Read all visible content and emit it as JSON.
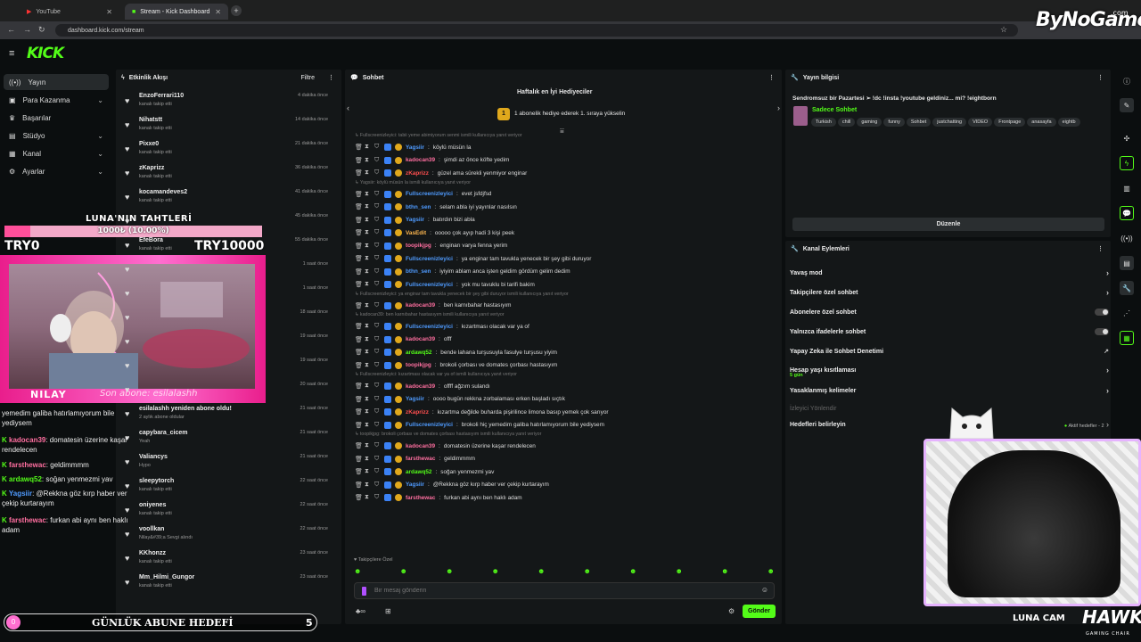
{
  "browser": {
    "tabs": [
      {
        "title": "YouTube",
        "active": false
      },
      {
        "title": "Stream - Kick Dashboard",
        "active": true
      }
    ],
    "url": "dashboard.kick.com/stream"
  },
  "brand": {
    "logo": "KICK",
    "watermark": "ByNoGame",
    "watermark_suffix": ".com",
    "accent": "#53fc18"
  },
  "sidebar": {
    "items": [
      {
        "label": "Yayın",
        "icon": "broadcast-icon",
        "active": true,
        "chevron": false
      },
      {
        "label": "Para Kazanma",
        "icon": "money-icon",
        "active": false,
        "chevron": true
      },
      {
        "label": "Başarılar",
        "icon": "trophy-icon",
        "active": false,
        "chevron": false
      },
      {
        "label": "Stüdyo",
        "icon": "studio-icon",
        "active": false,
        "chevron": true
      },
      {
        "label": "Kanal",
        "icon": "channel-icon",
        "active": false,
        "chevron": true
      },
      {
        "label": "Ayarlar",
        "icon": "gear-icon",
        "active": false,
        "chevron": true
      }
    ]
  },
  "activity": {
    "title": "Etkinlik Akışı",
    "filter": "Filtre",
    "items": [
      {
        "name": "EnzoFerrari110",
        "sub": "kanalı takip etti",
        "time": "4 dakika önce"
      },
      {
        "name": "Nihatstt",
        "sub": "kanalı takip etti",
        "time": "14 dakika önce"
      },
      {
        "name": "Pixxe0",
        "sub": "kanalı takip etti",
        "time": "21 dakika önce"
      },
      {
        "name": "zKaprizz",
        "sub": "kanalı takip etti",
        "time": "36 dakika önce"
      },
      {
        "name": "kocamandeves2",
        "sub": "kanalı takip etti",
        "time": "41 dakika önce"
      },
      {
        "name": "",
        "sub": "",
        "time": "45 dakika önce"
      },
      {
        "name": "EfeBora",
        "sub": "kanalı takip etti",
        "time": "55 dakika önce"
      },
      {
        "name": "",
        "sub": "",
        "time": "1 saat önce"
      },
      {
        "name": "",
        "sub": "",
        "time": "1 saat önce"
      },
      {
        "name": "",
        "sub": "",
        "time": "18 saat önce"
      },
      {
        "name": "",
        "sub": "",
        "time": "19 saat önce"
      },
      {
        "name": "",
        "sub": "",
        "time": "19 saat önce"
      },
      {
        "name": "",
        "sub": "",
        "time": "20 saat önce"
      },
      {
        "name": "esilalashh yeniden abone oldu!",
        "sub": "2 aylık abone oldular",
        "time": "21 saat önce"
      },
      {
        "name": "capybara_cicem",
        "sub": "Yeah",
        "time": "21 saat önce"
      },
      {
        "name": "Valiancys",
        "sub": "Hypo",
        "time": "21 saat önce"
      },
      {
        "name": "sleepytorch",
        "sub": "kanalı takip etti",
        "time": "22 saat önce"
      },
      {
        "name": "oniyenes",
        "sub": "kanalı takip etti",
        "time": "22 saat önce"
      },
      {
        "name": "voollkan",
        "sub": "Nilay&#39;a Sevgi alındı",
        "time": "22 saat önce"
      },
      {
        "name": "KKhonzz",
        "sub": "kanalı takip etti",
        "time": "23 saat önce"
      },
      {
        "name": "Mm_Hilmi_Gungor",
        "sub": "kanalı takip etti",
        "time": "23 saat önce"
      }
    ]
  },
  "chat": {
    "title": "Sohbet",
    "gifter_title": "Haftalık en İyi Hediyeciler",
    "gifter_rank": "1",
    "gifter_text": "1 abonelik hediye ederek 1. sıraya yükselin",
    "lines": [
      {
        "type": "reply",
        "text": "Fullscreenizleyici: tabii yeme abimiyorum senmi ismili kullanıcıya yanıt veriyor"
      },
      {
        "user": "Yagsiir",
        "color": "#4f9bff",
        "text": "köylü müsün la"
      },
      {
        "user": "kadocan39",
        "color": "#ff6fa0",
        "text": "şimdi az önce köfte yedim"
      },
      {
        "user": "zKaprizz",
        "color": "#ff4f4f",
        "text": "güzel ama sürekli yenmiyor enginar"
      },
      {
        "type": "reply",
        "text": "Yagsiir: köylü müsün la ismili kullanıcıya yanıt veriyor"
      },
      {
        "user": "Fullscreenizleyici",
        "color": "#4f9bff",
        "text": "evet jsfdjfsd"
      },
      {
        "user": "bthn_sen",
        "color": "#4f9bff",
        "text": "selam abla iyi yayınlar nasılsın"
      },
      {
        "user": "Yagsiir",
        "color": "#4f9bff",
        "text": "batırdın bizi abla"
      },
      {
        "user": "VasEdit",
        "color": "#ffb84f",
        "text": "ooooo çok ayıp hadi 3 kişi peek"
      },
      {
        "user": "toopikjpg",
        "color": "#ff6fa0",
        "text": "enginarı varya fenna yerim"
      },
      {
        "user": "Fullscreenizleyici",
        "color": "#4f9bff",
        "text": "ya enginar tam tavukla yenecek bir şey gibi duruyor"
      },
      {
        "user": "bthn_sen",
        "color": "#4f9bff",
        "text": "iyiyim ablam anca işten geldim gördüm gelim dedim"
      },
      {
        "user": "Fullscreenizleyici",
        "color": "#4f9bff",
        "text": "yok mu tavuklu bi tarifi bakim"
      },
      {
        "type": "reply",
        "text": "Fullscreenizleyici: ya enginar tam tavukla yenecek bir şey gibi duruyor ismili kullanıcıya yanıt veriyor"
      },
      {
        "user": "kadocan39",
        "color": "#ff6fa0",
        "text": "ben karnıbahar hastasıyım"
      },
      {
        "type": "reply",
        "text": "kadocan39: ben karnıbahar hastasıyım ismili kullanıcıya yanıt veriyor"
      },
      {
        "user": "Fullscreenizleyici",
        "color": "#4f9bff",
        "text": "kızartması olacak var ya of"
      },
      {
        "user": "kadocan39",
        "color": "#ff6fa0",
        "text": "offf"
      },
      {
        "user": "ardawq52",
        "color": "#53fc18",
        "text": "bende lahana turşusuyla fasulye turşusu yiyim"
      },
      {
        "user": "toopikjpg",
        "color": "#ff6fa0",
        "text": "brokoli çorbası ve domates çorbası hastasıyım"
      },
      {
        "type": "reply",
        "text": "Fullscreenizleyici: kızartması olacak var ya of ismili kullanıcıya yanıt veriyor"
      },
      {
        "user": "kadocan39",
        "color": "#ff6fa0",
        "text": "offff ağzım sulandı"
      },
      {
        "user": "Yagsiir",
        "color": "#4f9bff",
        "text": "oooo bugün rekkna zorbalaması erken başladı sıçtık"
      },
      {
        "user": "zKaprizz",
        "color": "#ff4f4f",
        "text": "kızartma değilde buharda pişirilince limona basıp yemek çok sarıyor"
      },
      {
        "user": "Fullscreenizleyici",
        "color": "#4f9bff",
        "text": "brokoli hiç yemedim galiba hatırlamıyorum bile yediysem"
      },
      {
        "type": "reply",
        "text": "toopikjpg: brokoli çorbası ve domates çorbası hastasıyım ismili kullanıcıya yanıt veriyor"
      },
      {
        "user": "kadocan39",
        "color": "#ff6fa0",
        "text": "domatesin üzerine kaşar rendelecen"
      },
      {
        "user": "farsthewac",
        "color": "#ff6fa0",
        "text": "geldimmmm"
      },
      {
        "user": "ardawq52",
        "color": "#53fc18",
        "text": "soğan yenmezmi yav"
      },
      {
        "user": "Yagsiir",
        "color": "#4f9bff",
        "text": "@Rekkna göz kırp haber ver çekip kurtarayım"
      },
      {
        "user": "farsthewac",
        "color": "#ff6fa0",
        "text": "furkan abi aynı ben haklı adam"
      }
    ],
    "followers_only": "Takipçilere Özel",
    "input_placeholder": "Bir mesaj gönderin",
    "send_label": "Gönder"
  },
  "stream_info": {
    "title": "Yayın bilgisi",
    "stream_title": "Sendromsuz bir Pazartesi ➢ !dc !insta !youtube geldiniz... mi? !eightborn",
    "category": "Sadece Sohbet",
    "tags": [
      "Turkish",
      "chill",
      "gaming",
      "funny",
      "Sohbet",
      "justchatting",
      "VIDEO",
      "Frontpage",
      "anasayfa",
      "eightb"
    ],
    "edit_label": "Düzenle"
  },
  "channel_actions": {
    "title": "Kanal Eylemleri",
    "items": [
      {
        "label": "Yavaş mod",
        "control": "chevron"
      },
      {
        "label": "Takipçilere özel sohbet",
        "control": "chevron"
      },
      {
        "label": "Abonelere özel sohbet",
        "control": "toggle"
      },
      {
        "label": "Yalnızca ifadelerle sohbet",
        "control": "toggle"
      },
      {
        "label": "Yapay Zeka ile Sohbet Denetimi",
        "control": "external"
      },
      {
        "label": "Hesap yaşı kısıtlaması",
        "sub": "5 gün",
        "control": "chevron"
      },
      {
        "label": "Yasaklanmış kelimeler",
        "control": "chevron"
      },
      {
        "label": "İzleyici Yönlendir",
        "control": "none",
        "disabled": true
      },
      {
        "label": "Hedefleri belirleyin",
        "control": "goals",
        "extra": "Aktif hedefler - 2"
      }
    ]
  },
  "overlay": {
    "goal_title": "LUNA'NIN TAHTLERİ",
    "goal_progress_text": "1000₺ (10.00%)",
    "goal_progress": 0.1,
    "goal_min": "TRY0",
    "goal_max": "TRY10000",
    "cam_name": "NILAY",
    "last_sub": "Son abone: esilalashh",
    "chat": [
      {
        "user": "",
        "text": "yemedim galiba hatırlamıyorum bile yediysem"
      },
      {
        "user": "kadocan39",
        "color": "#ff6fa0",
        "text": ": domatesin üzerine kaşar rendelecen"
      },
      {
        "user": "farsthewac",
        "color": "#ff6fa0",
        "text": ": geldimmmm"
      },
      {
        "user": "ardawq52",
        "color": "#53fc18",
        "text": ": soğan yenmezmi yav"
      },
      {
        "user": "Yagsiir",
        "color": "#4f9bff",
        "text": ": @Rekkna göz kırp haber ver çekip kurtarayım"
      },
      {
        "user": "farsthewac",
        "color": "#ff6fa0",
        "text": ": furkan abi aynı ben haklı adam"
      }
    ],
    "daily_goal_label": "GÜNLÜK ABUNE HEDEFİ",
    "daily_goal_current": "0",
    "daily_goal_target": "5",
    "cat_cam_label": "LUNA CAM",
    "hawk": "HAWK",
    "hawk_sub": "GAMING CHAIR"
  }
}
